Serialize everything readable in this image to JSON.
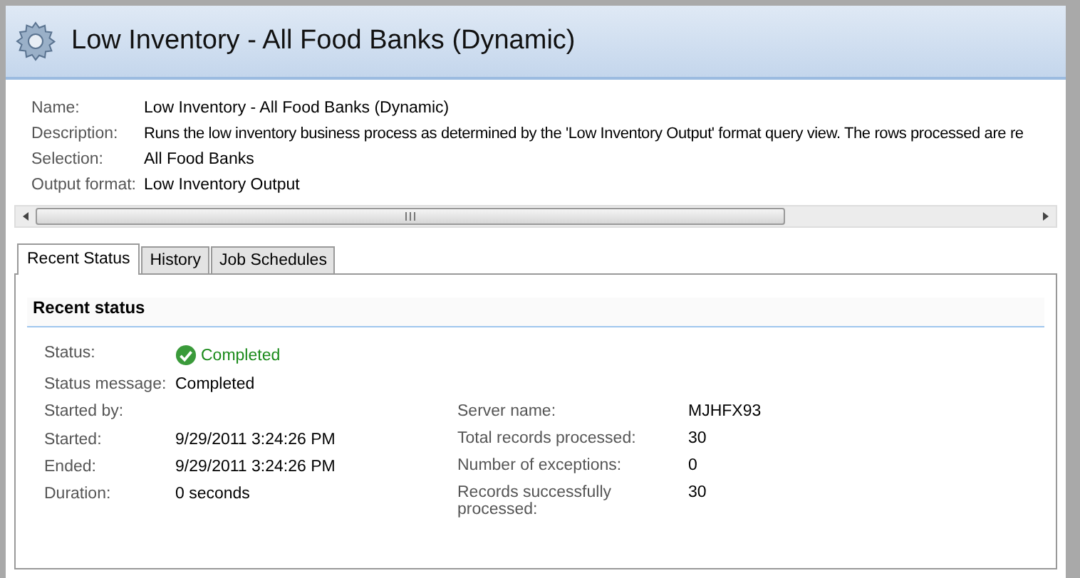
{
  "window": {
    "title": "Low Inventory  - All Food Banks (Dynamic)"
  },
  "details": [
    {
      "label": "Name:",
      "value": "Low Inventory  - All Food Banks (Dynamic)"
    },
    {
      "label": "Description:",
      "value": "Runs the low inventory business process as determined by the 'Low Inventory Output' format query view.  The rows processed are re"
    },
    {
      "label": "Selection:",
      "value": "All Food Banks"
    },
    {
      "label": "Output format:",
      "value": "Low Inventory Output"
    }
  ],
  "tabs": [
    {
      "label": "Recent Status",
      "selected": true
    },
    {
      "label": "History",
      "selected": false
    },
    {
      "label": "Job Schedules",
      "selected": false
    }
  ],
  "section": {
    "title": "Recent status"
  },
  "status": {
    "label": "Status:",
    "value": "Completed",
    "kind": "success"
  },
  "status_message": {
    "label": "Status message:",
    "value": "Completed"
  },
  "left_fields": [
    {
      "label": "Started by:"
    },
    {
      "label": "Started:",
      "value": "9/29/2011 3:24:26 PM"
    },
    {
      "label": "Ended:",
      "value": "9/29/2011 3:24:26 PM"
    },
    {
      "label": "Duration:",
      "value": "0 seconds"
    }
  ],
  "right_fields": [
    {
      "label": "Server name:",
      "value": "MJHFX93"
    },
    {
      "label": "Total records processed:",
      "value": "30"
    },
    {
      "label": "Number of exceptions:",
      "value": "0"
    },
    {
      "label": "Records successfully processed:",
      "value": "30"
    }
  ]
}
